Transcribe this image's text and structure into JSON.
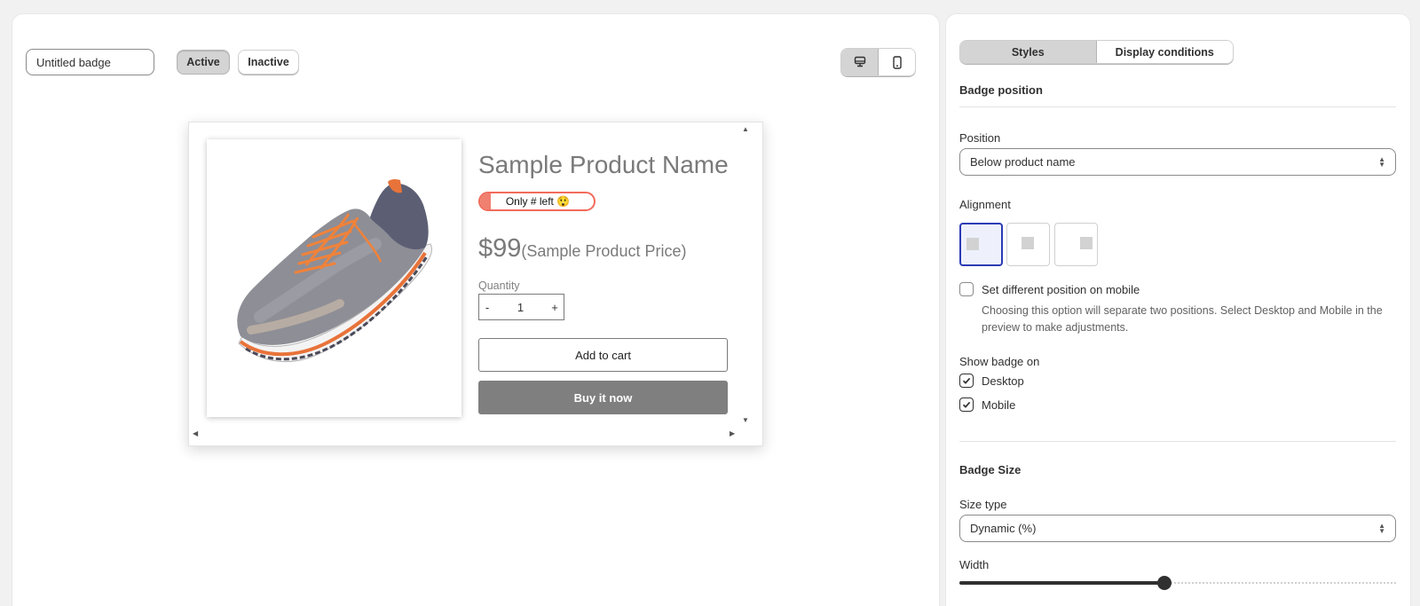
{
  "editor": {
    "badge_name": "Untitled badge",
    "status_active_label": "Active",
    "status_inactive_label": "Inactive",
    "device_options": [
      "desktop-icon",
      "mobile-icon"
    ],
    "selected_device": "desktop"
  },
  "preview": {
    "product_name": "Sample Product Name",
    "badge_text": "Only # left 😲",
    "price": "$99",
    "price_note": "(Sample Product Price)",
    "quantity_label": "Quantity",
    "quantity_minus": "-",
    "quantity_value": "1",
    "quantity_plus": "+",
    "add_to_cart_label": "Add to cart",
    "buy_now_label": "Buy it now",
    "badge_colors": {
      "border": "#f26b5b",
      "fill": "#f08070"
    }
  },
  "settings": {
    "tabs": [
      "Styles",
      "Display conditions"
    ],
    "active_tab": "Styles",
    "badge_position_title": "Badge position",
    "position_label": "Position",
    "position_value": "Below product name",
    "alignment_label": "Alignment",
    "alignment_options": [
      "left",
      "center",
      "right"
    ],
    "alignment_selected": "left",
    "mobile_position_label": "Set different position on mobile",
    "mobile_position_checked": false,
    "mobile_position_help": "Choosing this option will separate two positions. Select Desktop and Mobile in the preview to make adjustments.",
    "show_badge_label": "Show badge on",
    "desktop_label": "Desktop",
    "desktop_checked": true,
    "mobile_label": "Mobile",
    "mobile_checked": true,
    "badge_size_title": "Badge Size",
    "size_type_label": "Size type",
    "size_type_value": "Dynamic (%)",
    "width_label": "Width",
    "width_fraction": 0.47,
    "accent_color": "#2c3bb5"
  }
}
